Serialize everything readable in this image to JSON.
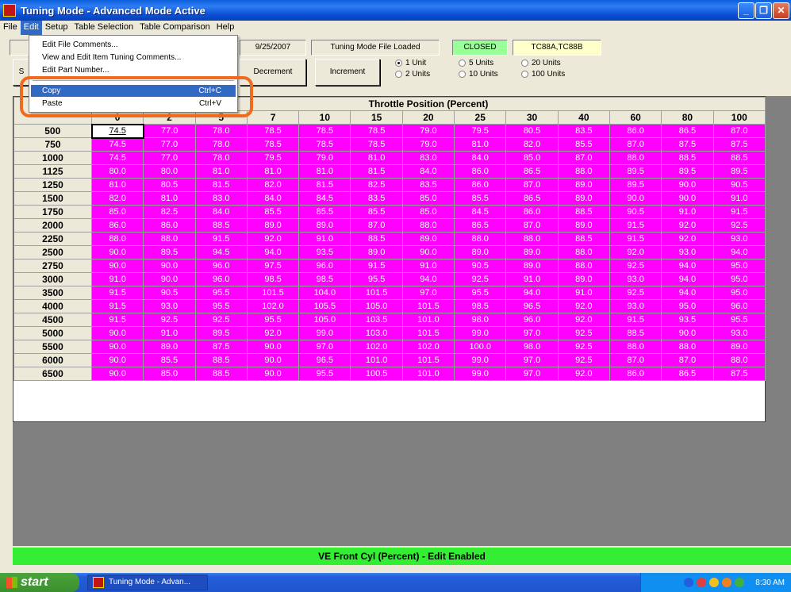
{
  "window": {
    "title": "Tuning Mode - Advanced Mode Active"
  },
  "menubar": [
    "File",
    "Edit",
    "Setup",
    "Table Selection",
    "Table Comparison",
    "Help"
  ],
  "edit_menu": {
    "items": [
      {
        "label": "Edit File Comments...",
        "shortcut": ""
      },
      {
        "label": "View and Edit Item Tuning Comments...",
        "shortcut": ""
      },
      {
        "label": "Edit Part Number...",
        "shortcut": ""
      },
      {
        "label": "Copy",
        "shortcut": "Ctrl+C"
      },
      {
        "label": "Paste",
        "shortcut": "Ctrl+V"
      }
    ]
  },
  "toolbar": {
    "date": "9/25/2007",
    "file_status": "Tuning Mode File Loaded",
    "loop_status": "CLOSED",
    "part": "TC88A,TC88B",
    "left_button": "S",
    "decrement": "Decrement",
    "increment": "Increment",
    "units": [
      "1 Unit",
      "2 Units",
      "5 Units",
      "10 Units",
      "20 Units",
      "100 Units"
    ],
    "selected_unit": "1 Unit"
  },
  "table": {
    "title": "Throttle Position (Percent)",
    "corner": "",
    "columns": [
      "0",
      "2",
      "5",
      "7",
      "10",
      "15",
      "20",
      "25",
      "30",
      "40",
      "60",
      "80",
      "100"
    ],
    "rows": [
      {
        "rpm": "500",
        "v": [
          "74.5",
          "77.0",
          "78.0",
          "78.5",
          "78.5",
          "78.5",
          "79.0",
          "79.5",
          "80.5",
          "83.5",
          "86.0",
          "86.5",
          "87.0"
        ]
      },
      {
        "rpm": "750",
        "v": [
          "74.5",
          "77.0",
          "78.0",
          "78.5",
          "78.5",
          "78.5",
          "79.0",
          "81.0",
          "82.0",
          "85.5",
          "87.0",
          "87.5",
          "87.5"
        ]
      },
      {
        "rpm": "1000",
        "v": [
          "74.5",
          "77.0",
          "78.0",
          "79.5",
          "79.0",
          "81.0",
          "83.0",
          "84.0",
          "85.0",
          "87.0",
          "88.0",
          "88.5",
          "88.5"
        ]
      },
      {
        "rpm": "1125",
        "v": [
          "80.0",
          "80.0",
          "81.0",
          "81.0",
          "81.0",
          "81.5",
          "84.0",
          "86.0",
          "86.5",
          "88.0",
          "89.5",
          "89.5",
          "89.5"
        ]
      },
      {
        "rpm": "1250",
        "v": [
          "81.0",
          "80.5",
          "81.5",
          "82.0",
          "81.5",
          "82.5",
          "83.5",
          "86.0",
          "87.0",
          "89.0",
          "89.5",
          "90.0",
          "90.5"
        ]
      },
      {
        "rpm": "1500",
        "v": [
          "82.0",
          "81.0",
          "83.0",
          "84.0",
          "84.5",
          "83.5",
          "85.0",
          "85.5",
          "86.5",
          "89.0",
          "90.0",
          "90.0",
          "91.0"
        ]
      },
      {
        "rpm": "1750",
        "v": [
          "85.0",
          "82.5",
          "84.0",
          "85.5",
          "85.5",
          "85.5",
          "85.0",
          "84.5",
          "86.0",
          "88.5",
          "90.5",
          "91.0",
          "91.5"
        ]
      },
      {
        "rpm": "2000",
        "v": [
          "86.0",
          "86.0",
          "88.5",
          "89.0",
          "89.0",
          "87.0",
          "88.0",
          "86.5",
          "87.0",
          "89.0",
          "91.5",
          "92.0",
          "92.5"
        ]
      },
      {
        "rpm": "2250",
        "v": [
          "88.0",
          "88.0",
          "91.5",
          "92.0",
          "91.0",
          "88.5",
          "89.0",
          "88.0",
          "88.0",
          "88.5",
          "91.5",
          "92.0",
          "93.0"
        ]
      },
      {
        "rpm": "2500",
        "v": [
          "90.0",
          "89.5",
          "94.5",
          "94.0",
          "93.5",
          "89.0",
          "90.0",
          "89.0",
          "89.0",
          "88.0",
          "92.0",
          "93.0",
          "94.0"
        ]
      },
      {
        "rpm": "2750",
        "v": [
          "90.0",
          "90.0",
          "96.0",
          "97.5",
          "96.0",
          "91.5",
          "91.0",
          "90.5",
          "89.0",
          "88.0",
          "92.5",
          "94.0",
          "95.0"
        ]
      },
      {
        "rpm": "3000",
        "v": [
          "91.0",
          "90.0",
          "96.0",
          "98.5",
          "98.5",
          "95.5",
          "94.0",
          "92.5",
          "91.0",
          "89.0",
          "93.0",
          "94.0",
          "95.0"
        ]
      },
      {
        "rpm": "3500",
        "v": [
          "91.5",
          "90.5",
          "95.5",
          "101.5",
          "104.0",
          "101.5",
          "97.0",
          "95.5",
          "94.0",
          "91.0",
          "92.5",
          "94.0",
          "95.0"
        ]
      },
      {
        "rpm": "4000",
        "v": [
          "91.5",
          "93.0",
          "95.5",
          "102.0",
          "105.5",
          "105.0",
          "101.5",
          "98.5",
          "96.5",
          "92.0",
          "93.0",
          "95.0",
          "96.0"
        ]
      },
      {
        "rpm": "4500",
        "v": [
          "91.5",
          "92.5",
          "92.5",
          "95.5",
          "105.0",
          "103.5",
          "101.0",
          "98.0",
          "96.0",
          "92.0",
          "91.5",
          "93.5",
          "95.5"
        ]
      },
      {
        "rpm": "5000",
        "v": [
          "90.0",
          "91.0",
          "89.5",
          "92.0",
          "99.0",
          "103.0",
          "101.5",
          "99.0",
          "97.0",
          "92.5",
          "88.5",
          "90.0",
          "93.0"
        ]
      },
      {
        "rpm": "5500",
        "v": [
          "90.0",
          "89.0",
          "87.5",
          "90.0",
          "97.0",
          "102.0",
          "102.0",
          "100.0",
          "98.0",
          "92.5",
          "88.0",
          "88.0",
          "89.0"
        ]
      },
      {
        "rpm": "6000",
        "v": [
          "90.0",
          "85.5",
          "88.5",
          "90.0",
          "96.5",
          "101.0",
          "101.5",
          "99.0",
          "97.0",
          "92.5",
          "87.0",
          "87.0",
          "88.0"
        ]
      },
      {
        "rpm": "6500",
        "v": [
          "90.0",
          "85.0",
          "88.5",
          "90.0",
          "95.5",
          "100.5",
          "101.0",
          "99.0",
          "97.0",
          "92.0",
          "86.0",
          "86.5",
          "87.5"
        ]
      }
    ]
  },
  "status": "VE Front Cyl (Percent) - Edit Enabled",
  "taskbar": {
    "start": "start",
    "task": "Tuning Mode - Advan...",
    "clock": "8:30 AM"
  }
}
